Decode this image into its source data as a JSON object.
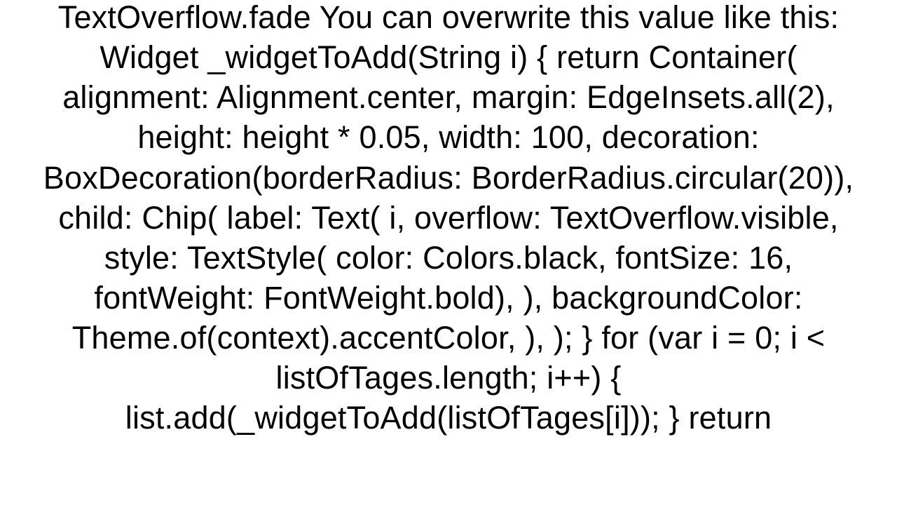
{
  "text": "TextOverflow.fade You can overwrite this value like this: Widget _widgetToAdd(String i) {     return Container(       alignment: Alignment.center,       margin: EdgeInsets.all(2),       height: height * 0.05,       width: 100,       decoration: BoxDecoration(borderRadius: BorderRadius.circular(20)),       child: Chip(         label: Text(           i,           overflow: TextOverflow.visible,           style: TextStyle(               color: Colors.black, fontSize: 16, fontWeight: FontWeight.bold),         ),         backgroundColor: Theme.of(context).accentColor,       ),     );   }   for (var i = 0; i < listOfTages.length; i++) {    list.add(_widgetToAdd(listOfTages[i]));   }   return"
}
